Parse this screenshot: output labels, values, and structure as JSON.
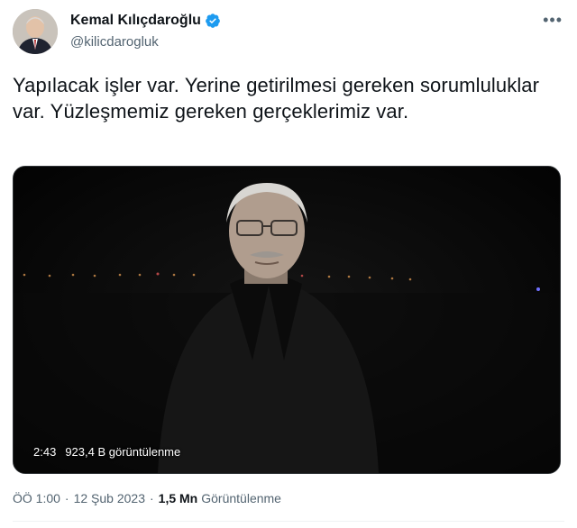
{
  "author": {
    "name": "Kemal Kılıçdaroğlu",
    "handle": "@kilicdarogluk",
    "verified_color": "#1d9bf0"
  },
  "more_icon": "•••",
  "tweet": {
    "text": "Yapılacak işler var. Yerine getirilmesi gereken sorumluluklar var. Yüzleşmemiz gereken gerçeklerimiz var."
  },
  "video": {
    "duration": "2:43",
    "views": "923,4 B görüntülenme",
    "play_icon": "video-player"
  },
  "meta": {
    "time": "ÖÖ 1:00",
    "date": "12 Şub 2023",
    "separator": "·",
    "views_count": "1,5 Mn",
    "views_label": "Görüntülenme"
  }
}
